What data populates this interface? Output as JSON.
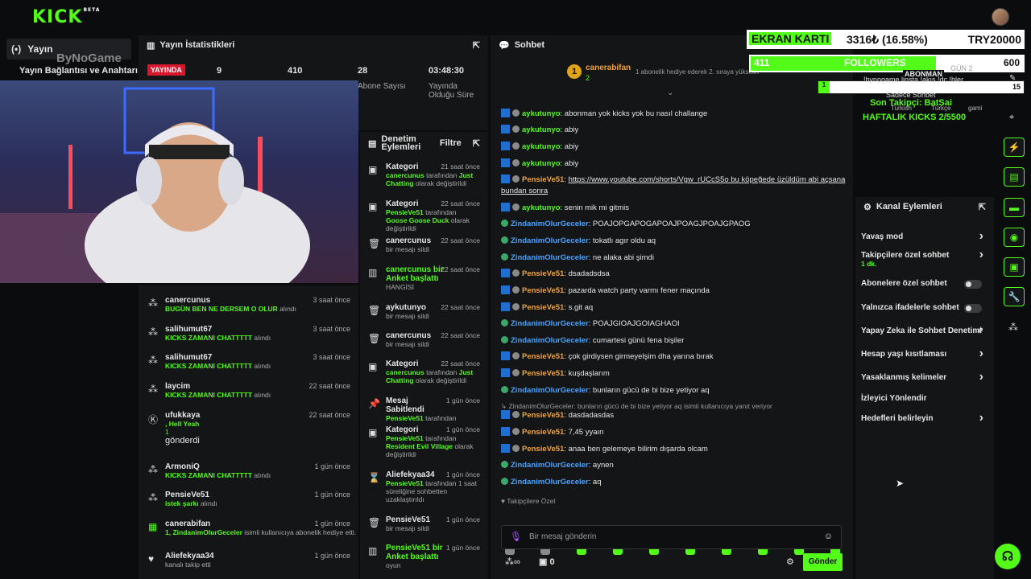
{
  "app": {
    "logo": "KICK",
    "beta": "BETA"
  },
  "left": {
    "tab": "Yayın",
    "conn": "Yayın Bağlantısı ve Anahtarı",
    "watermark": "ByNoGame"
  },
  "stats": {
    "title": "Yayın İstatistikleri",
    "live": "YAYINDA",
    "viewers": "9",
    "followers": "410",
    "subs": "28",
    "subs_label": "Abone Sayısı",
    "duration": "03:48:30",
    "duration_label": "Yayında Olduğu Süre"
  },
  "activity": [
    {
      "name": "canercunus",
      "time": "3 saat önce",
      "desc": "BUGÜN BEN NE DERSEM O OLUR",
      "suffix": "alındı"
    },
    {
      "name": "salihumut67",
      "time": "3 saat önce",
      "desc": "KICKS ZAMANI CHATTTTT",
      "suffix": "alındı"
    },
    {
      "name": "salihumut67",
      "time": "3 saat önce",
      "desc": "KICKS ZAMANI CHATTTTT",
      "suffix": "alındı"
    },
    {
      "name": "laycim",
      "time": "22 saat önce",
      "desc": "KICKS ZAMANI CHATTTTT",
      "suffix": "alındı"
    },
    {
      "name": "ufukkaya",
      "time": "22 saat önce",
      "desc": ", Hell Yeah",
      "extra": "1",
      "suffix": "gönderdi"
    },
    {
      "name": "ArmoniQ",
      "time": "1 gün önce",
      "desc": "KICKS ZAMANI CHATTTTT",
      "suffix": "alındı"
    },
    {
      "name": "PensieVe51",
      "time": "1 gün önce",
      "desc": "istek şarkı",
      "suffix": "alındı"
    },
    {
      "name": "canerabifan",
      "time": "1 gün önce",
      "desc": "1, ZindanimOlurGeceler",
      "suffix": "isimli kullanıcıya abonelik hediye etti."
    },
    {
      "name": "Aliefekyaa34",
      "time": "1 gün önce",
      "desc": "",
      "suffix": "kanalı takip etti"
    }
  ],
  "mod": {
    "title": "Denetim Eylemleri",
    "filter": "Filtre",
    "items": [
      {
        "name": "Kategori",
        "time": "21 saat önce",
        "user": "canercunus",
        "mid": "tarafından",
        "hl": "Just Chatting",
        "end": "olarak değiştirildi"
      },
      {
        "name": "Kategori",
        "time": "22 saat önce",
        "user": "PensieVe51",
        "mid": "tarafından",
        "hl": "Goose Goose Duck",
        "end": "olarak değiştirildi"
      },
      {
        "name": "canercunus",
        "time": "22 saat önce",
        "user": "",
        "mid": "bir mesajı sildi",
        "hl": "",
        "end": ""
      },
      {
        "name": "canercunus bir Anket başlattı",
        "time": "22 saat önce",
        "user": "",
        "mid": "HANGİSİ",
        "hl": "",
        "end": ""
      },
      {
        "name": "aykutunyo",
        "time": "22 saat önce",
        "user": "",
        "mid": "bir mesajı sildi",
        "hl": "",
        "end": ""
      },
      {
        "name": "canercunus",
        "time": "22 saat önce",
        "user": "",
        "mid": "bir mesajı sildi",
        "hl": "",
        "end": ""
      },
      {
        "name": "Kategori",
        "time": "22 saat önce",
        "user": "canercunus",
        "mid": "tarafından",
        "hl": "Just Chatting",
        "end": "olarak değiştirildi"
      },
      {
        "name": "Mesaj Sabitlendi",
        "time": "1 gün önce",
        "user": "PensieVe51",
        "mid": "tarafından",
        "hl": "",
        "end": ""
      },
      {
        "name": "Kategori",
        "time": "1 gün önce",
        "user": "PensieVe51",
        "mid": "tarafından",
        "hl": "Resident Evil Village",
        "end": "olarak değiştirildi"
      },
      {
        "name": "Aliefekyaa34",
        "time": "1 gün önce",
        "user": "PensieVe51",
        "mid": "tarafından 1 saat süreliğine sohbetten uzaklaştırıldı",
        "hl": "",
        "end": ""
      },
      {
        "name": "PensieVe51",
        "time": "1 gün önce",
        "user": "",
        "mid": "bir mesajı sildi",
        "hl": "",
        "end": ""
      },
      {
        "name": "PensieVe51 bir Anket başlattı",
        "time": "1 gün önce",
        "user": "",
        "mid": "oyun",
        "hl": "",
        "end": ""
      }
    ]
  },
  "chat": {
    "title": "Sohbet",
    "gifter": "canerabifan",
    "gift_count": "2",
    "gift_text": "1 abonelik hediye ederek 2. sıraya yükselin",
    "messages": [
      {
        "u": "aykutunyo",
        "c": "g",
        "b": 2,
        "t": "abonman yok kicks yok bu nasıl challange"
      },
      {
        "u": "aykutunyo",
        "c": "g",
        "b": 2,
        "t": "abiy"
      },
      {
        "u": "aykutunyo",
        "c": "g",
        "b": 2,
        "t": "abiy"
      },
      {
        "u": "aykutunyo",
        "c": "g",
        "b": 2,
        "t": "abiy"
      },
      {
        "u": "PensieVe51",
        "c": "o",
        "b": 2,
        "t": "https://www.youtube.com/shorts/Vgw_rUCcS5o bu köpeğede üzüldüm abi açsana bundan sonra"
      },
      {
        "u": "aykutunyo",
        "c": "g",
        "b": 2,
        "t": "senin mik mi gitmis"
      },
      {
        "u": "ZindanimOlurGeceler",
        "c": "b",
        "b": 1,
        "t": "POAJOPGAPOGAPOAJPOAGJPOAJGPAOG"
      },
      {
        "u": "ZindanimOlurGeceler",
        "c": "b",
        "b": 1,
        "t": "tokatlı agır oldu aq"
      },
      {
        "u": "ZindanimOlurGeceler",
        "c": "b",
        "b": 1,
        "t": "ne alaka abi şimdi"
      },
      {
        "u": "PensieVe51",
        "c": "o",
        "b": 2,
        "t": "dsadadsdsa"
      },
      {
        "u": "PensieVe51",
        "c": "o",
        "b": 2,
        "t": "pazarda watch party varmı fener maçında"
      },
      {
        "u": "PensieVe51",
        "c": "o",
        "b": 2,
        "t": "s.git aq"
      },
      {
        "u": "ZindanimOlurGeceler",
        "c": "b",
        "b": 1,
        "t": "POAJGIOAJGOIAGHAOI"
      },
      {
        "u": "ZindanimOlurGeceler",
        "c": "b",
        "b": 1,
        "t": "cumartesi günü fena bişiler"
      },
      {
        "u": "PensieVe51",
        "c": "o",
        "b": 2,
        "t": "çok girdiysen girmeyelşim dha yarına bırak"
      },
      {
        "u": "PensieVe51",
        "c": "o",
        "b": 2,
        "t": "kuşdaşlarım"
      },
      {
        "u": "ZindanimOlurGeceler",
        "c": "b",
        "b": 1,
        "t": "bunların gücü de bi bize yetiyor aq"
      },
      {
        "u": "PensieVe51",
        "c": "o",
        "b": 2,
        "t": "dasdadasdas"
      },
      {
        "u": "PensieVe51",
        "c": "o",
        "b": 2,
        "t": "7,45 yyaın"
      },
      {
        "u": "PensieVe51",
        "c": "o",
        "b": 2,
        "t": "anaa ben gelemeye bilirim dışarda olcam"
      },
      {
        "u": "ZindanimOlurGeceler",
        "c": "b",
        "b": 1,
        "t": "aynen"
      },
      {
        "u": "ZindanimOlurGeceler",
        "c": "b",
        "b": 1,
        "t": "aq"
      }
    ],
    "reply": "ZindanimOlurGeceler: bunların gücü de bi bize yetiyor aq isimli kullanıcıya yanıt veriyor",
    "followers_only": "Takipçilere Özel",
    "placeholder": "Bir mesaj gönderin",
    "points": "0",
    "send": "Gönder"
  },
  "overlay": {
    "card": "EKRAN KARTI",
    "price": "3316₺ (16.58%)",
    "goal": "TRY20000",
    "followers_label": "FOLLOWERS",
    "followers_val": "411",
    "followers_goal": "600",
    "sub_count": "1",
    "sub_label": "ABONMAN",
    "sub_goal": "15",
    "line1": "!bynogame linsta !akış !dc !bler...",
    "line2": "Sadece Sohbet",
    "last_follower": "Son Takipçi: BatSai",
    "weekly": "HAFTALIK KICKS 2/5500",
    "tag1": "Turkish",
    "tag2": "Türkçe",
    "tag3": "gami",
    "gun": "GÜN 2"
  },
  "chan": {
    "title": "Kanal Eylemleri",
    "items": [
      {
        "label": "Yavaş mod",
        "type": "chev"
      },
      {
        "label": "Takipçilere özel sohbet",
        "sub": "1 dk.",
        "type": "chev"
      },
      {
        "label": "Abonelere özel sohbet",
        "type": "toggle"
      },
      {
        "label": "Yalnızca ifadelerle sohbet",
        "type": "toggle"
      },
      {
        "label": "Yapay Zeka ile Sohbet Denetimi",
        "type": "ext"
      },
      {
        "label": "Hesap yaşı kısıtlaması",
        "type": "chev"
      },
      {
        "label": "Yasaklanmış kelimeler",
        "type": "chev"
      },
      {
        "label": "İzleyici Yönlendir",
        "type": "none"
      },
      {
        "label": "Hedefleri belirleyin",
        "type": "chev"
      }
    ]
  },
  "colors": {
    "accent": "#53fc18",
    "live": "#d6172c"
  }
}
